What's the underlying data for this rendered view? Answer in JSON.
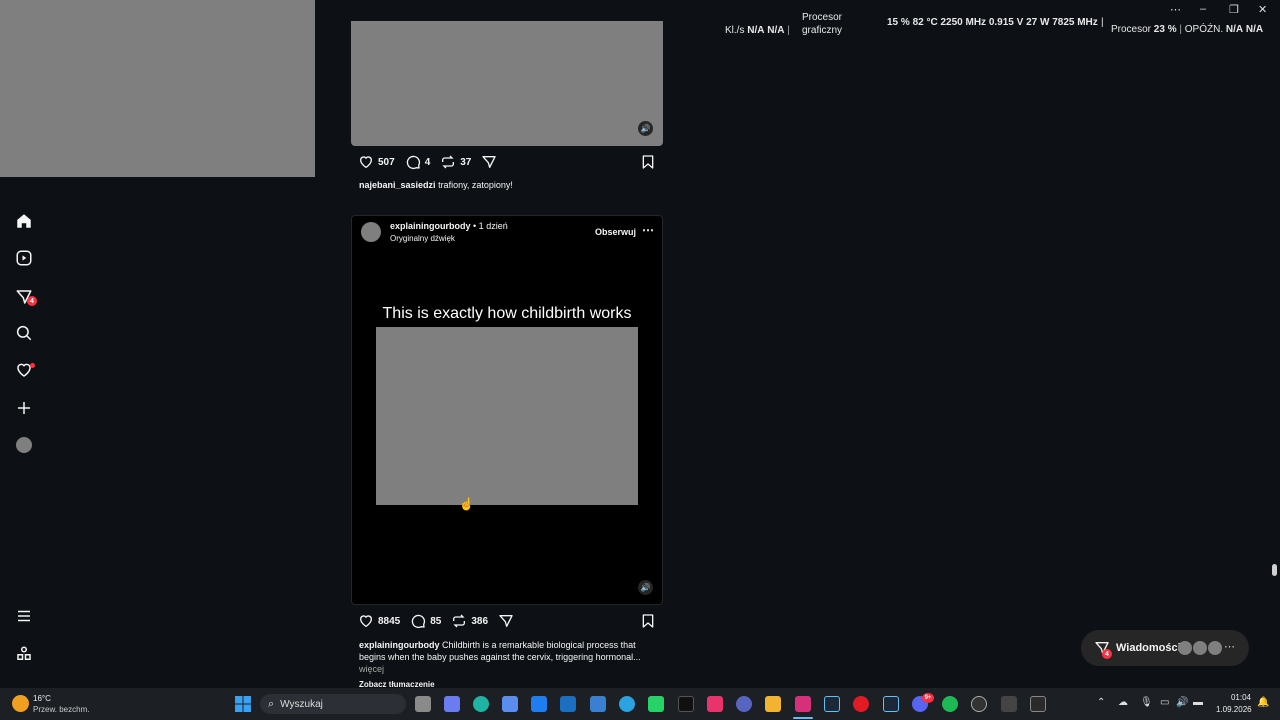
{
  "osd": {
    "fps_label": "Kl./s",
    "fps_value": "N/A",
    "fps_value2": "N/A",
    "gpu_label_1": "Procesor",
    "gpu_label_2": "graficzny",
    "gpu_stats": "15 % 82 °C 2250 MHz 0.915 V 27 W 7825 MHz",
    "cpu_label": "Procesor",
    "cpu_value": "23 %",
    "lat_label": "OPÓŹN.",
    "lat_value": "N/A",
    "lat_value2": "N/A"
  },
  "window_controls": {
    "menu": "⋯",
    "minimize": "–",
    "restore": "❐",
    "close": "✕"
  },
  "sidebar": {
    "notifications_badge": "4"
  },
  "posts": [
    {
      "likes": "507",
      "comments": "4",
      "reposts": "37",
      "username": "najebani_sasiedzi",
      "caption": "trafiony, zatopiony!"
    },
    {
      "username": "explainingourbody",
      "time": "• 1 dzień",
      "audio": "Oryginalny dźwięk",
      "follow": "Obserwuj",
      "video_text": "This is exactly how childbirth works",
      "likes": "8845",
      "comments": "85",
      "reposts": "386",
      "caption_user": "explainingourbody",
      "caption_line1": "Childbirth is a remarkable biological process that",
      "caption_line2": "begins when the baby pushes against the cervix, triggering hormonal...",
      "more": "więcej",
      "translate": "Zobacz tłumaczenie"
    }
  ],
  "messages_widget": {
    "label": "Wiadomości",
    "badge": "4",
    "more": "⋯"
  },
  "taskbar": {
    "weather_temp": "16°C",
    "weather_desc": "Przew. bezchm.",
    "search_placeholder": "Wyszukaj",
    "time": "01:04",
    "date": "1.09.2026",
    "discord_badge": "9+"
  },
  "colors": {
    "background": "#0d1014",
    "notification_red": "#ff3040",
    "taskbar": "#1c1f24"
  }
}
